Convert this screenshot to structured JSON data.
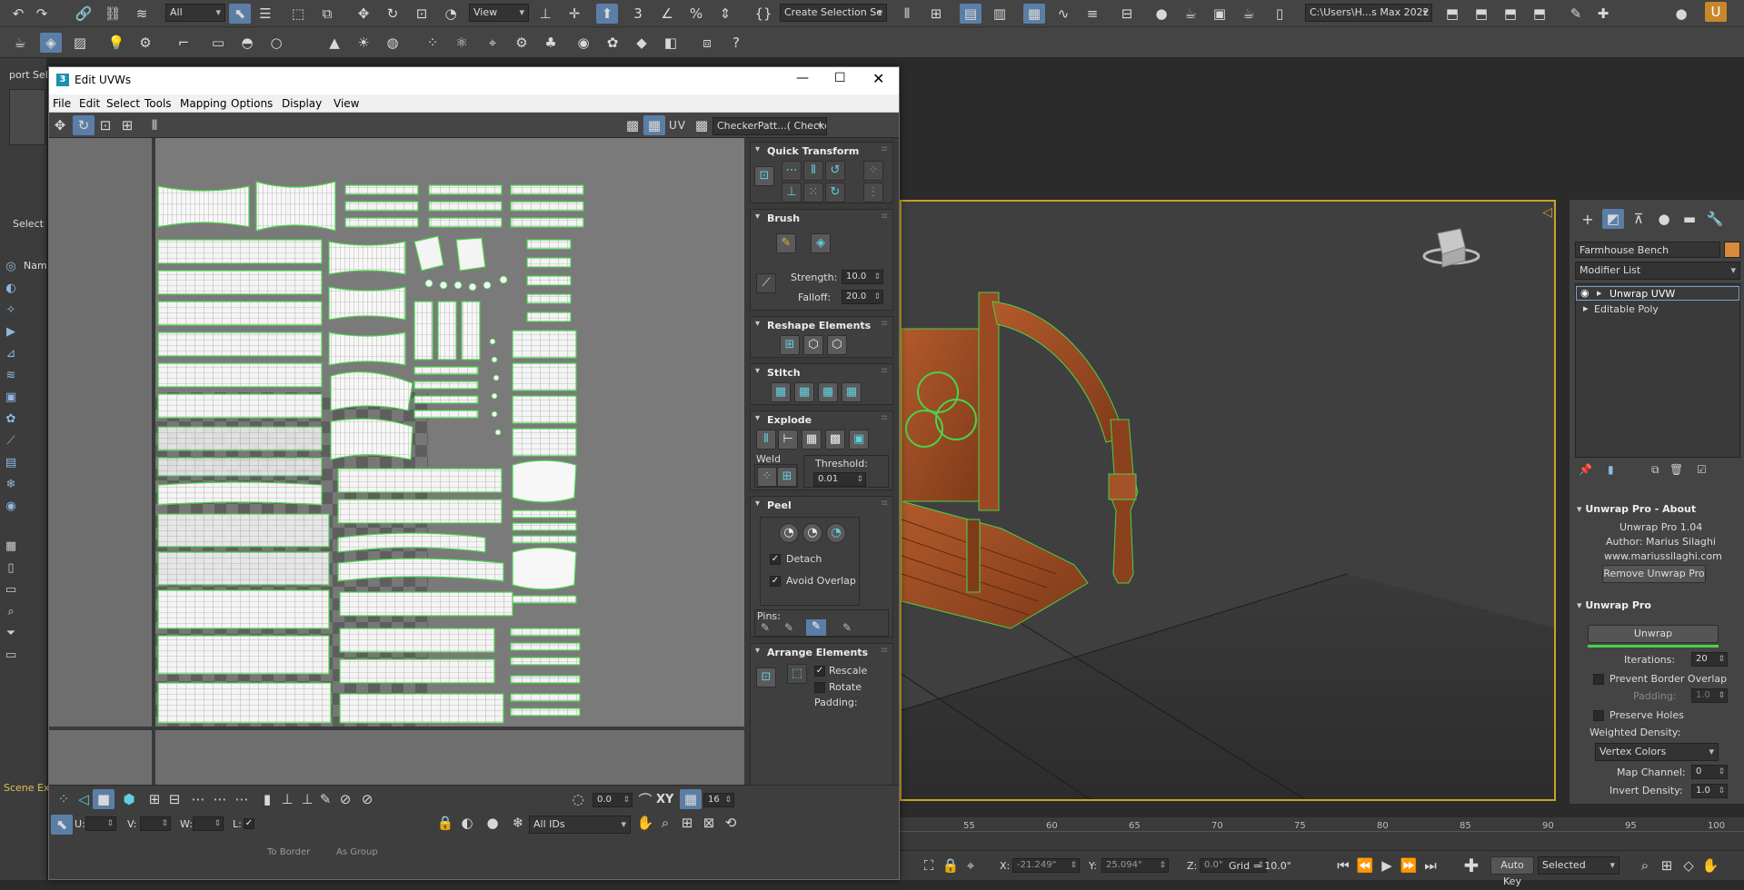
{
  "top_toolbar": {
    "selection_filter": "All",
    "viewport_combo": "View",
    "named_selection": "Create Selection Se",
    "project_path": "C:\\Users\\H...s Max 2022",
    "partial_label": "port Sel",
    "select_label": "Select",
    "name_label": "Nam",
    "scene_label": "Scene Ex"
  },
  "uvw_window": {
    "title": "Edit UVWs",
    "menu": [
      "File",
      "Edit",
      "Select",
      "Tools",
      "Mapping",
      "Options",
      "Display",
      "View"
    ],
    "uv_label": "UV",
    "checker_combo": "CheckerPatt...( Checker )",
    "rollouts": {
      "quick_transform": "Quick Transform",
      "brush": "Brush",
      "strength_label": "Strength:",
      "strength_value": "10.0",
      "falloff_label": "Falloff:",
      "falloff_value": "20.0",
      "reshape": "Reshape Elements",
      "stitch": "Stitch",
      "explode": "Explode",
      "weld_label": "Weld",
      "threshold_label": "Threshold:",
      "threshold_value": "0.01",
      "peel": "Peel",
      "detach_label": "Detach",
      "avoid_overlap_label": "Avoid Overlap",
      "pins_label": "Pins:",
      "arrange": "Arrange Elements",
      "rescale_label": "Rescale",
      "rotate_label": "Rotate",
      "padding_label": "Padding:"
    },
    "bottom": {
      "rotation_value": "0.0",
      "xy_label": "XY",
      "grid_value": "16",
      "u_label": "U:",
      "v_label": "V:",
      "w_label": "W:",
      "l_label": "L:",
      "ids_combo": "All IDs",
      "to_border": "To Border",
      "as_group": "As Group"
    }
  },
  "command_panel": {
    "object_name": "Farmhouse Bench",
    "modifier_list": "Modifier List",
    "stack": [
      "Unwrap UVW",
      "Editable Poly"
    ],
    "about_title": "Unwrap Pro - About",
    "about_version": "Unwrap Pro 1.04",
    "about_author": "Author: Marius Silaghi",
    "about_site": "www.mariussilaghi.com",
    "remove_button": "Remove Unwrap Pro",
    "pro_title": "Unwrap Pro",
    "unwrap_button": "Unwrap",
    "iterations_label": "Iterations:",
    "iterations_value": "20",
    "prevent_border_label": "Prevent Border Overlap",
    "padding_label": "Padding:",
    "padding_value": "1.0",
    "preserve_holes_label": "Preserve Holes",
    "weighted_density_label": "Weighted Density:",
    "density_combo": "Vertex Colors",
    "map_channel_label": "Map Channel:",
    "map_channel_value": "0",
    "invert_density_label": "Invert Density:",
    "invert_density_value": "1.0"
  },
  "timeline": {
    "ticks": [
      "55",
      "60",
      "65",
      "70",
      "75",
      "80",
      "85",
      "90",
      "95",
      "100"
    ]
  },
  "statusbar": {
    "x_label": "X:",
    "x_value": "-21.249\"",
    "y_label": "Y:",
    "y_value": "25.094\"",
    "z_label": "Z:",
    "z_value": "0.0\"",
    "grid": "Grid = 10.0\"",
    "auto_key": "Auto Key",
    "key_filter": "Selected"
  },
  "colors": {
    "accent": "#5b7ea6",
    "uv_edge": "#4ad14a",
    "viewport_border": "#c9a227",
    "wood": "#a04f26"
  }
}
